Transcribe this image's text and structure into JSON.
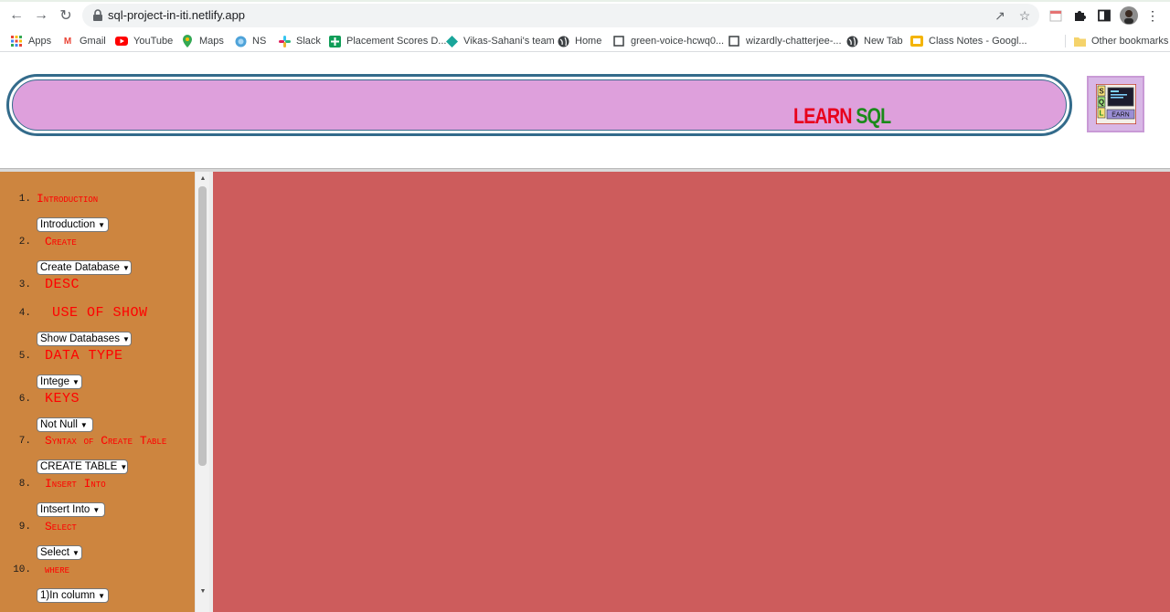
{
  "browser": {
    "url": "sql-project-in-iti.netlify.app",
    "bookmarks": [
      {
        "label": "Apps",
        "icon": "apps-grid-icon"
      },
      {
        "label": "Gmail",
        "icon": "gmail-icon"
      },
      {
        "label": "YouTube",
        "icon": "youtube-icon"
      },
      {
        "label": "Maps",
        "icon": "maps-pin-icon"
      },
      {
        "label": "NS",
        "icon": "ns-globe-icon"
      },
      {
        "label": "Slack",
        "icon": "slack-icon"
      },
      {
        "label": "Placement Scores D...",
        "icon": "sheets-plus-icon"
      },
      {
        "label": "Vikas-Sahani's team",
        "icon": "diamond-icon"
      },
      {
        "label": "Home",
        "icon": "globe-icon"
      },
      {
        "label": "green-voice-hcwq0...",
        "icon": "page-square-icon"
      },
      {
        "label": "wizardly-chatterjee-...",
        "icon": "page-square-icon"
      },
      {
        "label": "New Tab",
        "icon": "globe-icon"
      },
      {
        "label": "Class Notes - Googl...",
        "icon": "slides-icon"
      }
    ],
    "other_bookmarks": "Other bookmarks"
  },
  "header": {
    "title_learn": "LEARN",
    "title_sql": "SQL",
    "logo_letters": [
      "S",
      "Q",
      "L"
    ],
    "logo_word": "EARN"
  },
  "sidebar": {
    "items": [
      {
        "number": "1.",
        "title": "Introduction",
        "dropdown": "Introduction"
      },
      {
        "number": "2.",
        "title": "Create",
        "dropdown": "Create Database"
      },
      {
        "number": "3.",
        "title": "DESC",
        "dropdown": ""
      },
      {
        "number": "4.",
        "title": "USE OF SHOW",
        "dropdown": "Show Databases"
      },
      {
        "number": "5.",
        "title": "DATA TYPE",
        "dropdown": "Intege"
      },
      {
        "number": "6.",
        "title": "KEYS",
        "dropdown": "Not Null"
      },
      {
        "number": "7.",
        "title": "Syntax of Create Table",
        "dropdown": "CREATE TABLE"
      },
      {
        "number": "8.",
        "title": "Insert Into",
        "dropdown": "Intsert Into"
      },
      {
        "number": "9.",
        "title": "Select",
        "dropdown": "Select"
      },
      {
        "number": "10.",
        "title": "where",
        "dropdown": "1)In column"
      }
    ]
  },
  "colors": {
    "banner": "#dea0dc",
    "banner_border": "#336b8b",
    "learn": "#e8001c",
    "sql": "#1a8a1a",
    "sidebar": "#cd853f",
    "content": "#cd5c5c",
    "item_title": "#ff0000"
  }
}
